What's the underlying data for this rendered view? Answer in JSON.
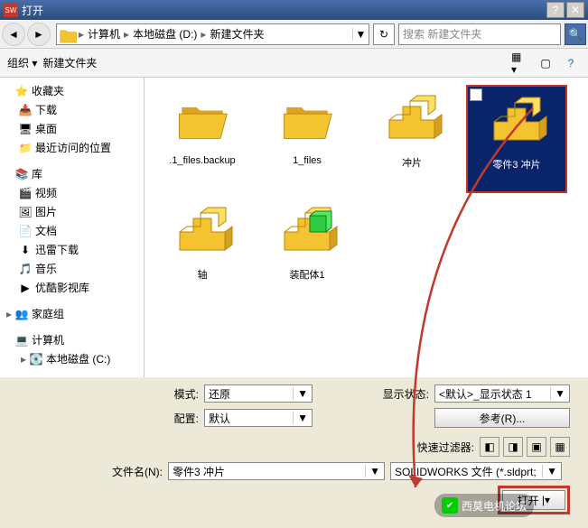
{
  "titlebar": {
    "title": "打开",
    "app_icon": "SW"
  },
  "nav": {
    "breadcrumbs": [
      "计算机",
      "本地磁盘 (D:)",
      "新建文件夹"
    ],
    "search_placeholder": "搜索 新建文件夹"
  },
  "toolbar": {
    "organize": "组织",
    "newfolder": "新建文件夹"
  },
  "sidebar": {
    "favorites": {
      "label": "收藏夹",
      "items": [
        "下载",
        "桌面",
        "最近访问的位置"
      ]
    },
    "libraries": {
      "label": "库",
      "items": [
        "视频",
        "图片",
        "文档",
        "迅雷下载",
        "音乐",
        "优酷影视库"
      ]
    },
    "homegroup": {
      "label": "家庭组"
    },
    "computer": {
      "label": "计算机",
      "items": [
        "本地磁盘 (C:)"
      ]
    }
  },
  "files": [
    {
      "name": ".1_files.backup",
      "type": "folder",
      "selected": false
    },
    {
      "name": "1_files",
      "type": "folder",
      "selected": false
    },
    {
      "name": "冲片",
      "type": "part",
      "selected": false
    },
    {
      "name": "零件3 冲片",
      "type": "part",
      "selected": true,
      "checked": true
    },
    {
      "name": "轴",
      "type": "part",
      "selected": false
    },
    {
      "name": "装配体1",
      "type": "assembly",
      "selected": false
    }
  ],
  "controls": {
    "mode_label": "模式:",
    "mode_value": "还原",
    "config_label": "配置:",
    "config_value": "默认",
    "display_label": "显示状态:",
    "display_value": "<默认>_显示状态 1",
    "refs_button": "参考(R)...",
    "filter_label": "快速过滤器:",
    "filename_label": "文件名(N):",
    "filename_value": "零件3 冲片",
    "filetype_value": "SOLIDWORKS 文件 (*.sldprt;",
    "open_button": "打开"
  },
  "watermark": "西莫电机论坛"
}
